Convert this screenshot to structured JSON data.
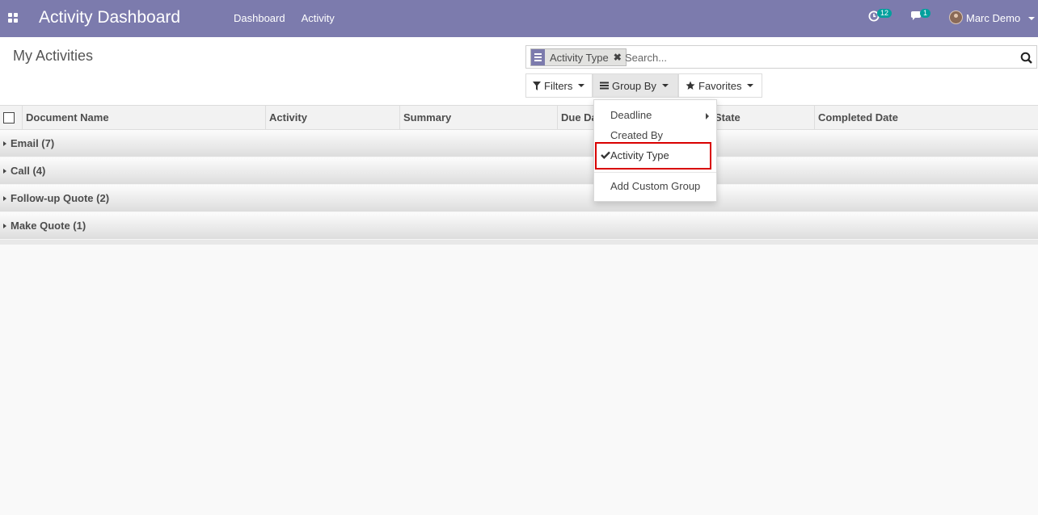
{
  "navbar": {
    "app_title": "Activity Dashboard",
    "menu": [
      "Dashboard",
      "Activity"
    ],
    "activity_count": "12",
    "message_count": "1",
    "user_name": "Marc Demo",
    "background_color": "#7c7bad"
  },
  "control_panel": {
    "breadcrumb": "My Activities",
    "search": {
      "facet_label": "Activity Type",
      "placeholder": "Search..."
    },
    "buttons": {
      "filters": "Filters",
      "group_by": "Group By",
      "favorites": "Favorites"
    }
  },
  "table": {
    "columns": [
      "Document Name",
      "Activity",
      "Summary",
      "Due Da",
      "State",
      "Completed Date"
    ],
    "groups": [
      "Email (7)",
      "Call (4)",
      "Follow-up Quote (2)",
      "Make Quote (1)"
    ]
  },
  "group_by_menu": {
    "items": [
      "Deadline",
      "Created By",
      "Activity Type"
    ],
    "selected": "Activity Type",
    "custom": "Add Custom Group",
    "highlight_color": "#d90000"
  }
}
